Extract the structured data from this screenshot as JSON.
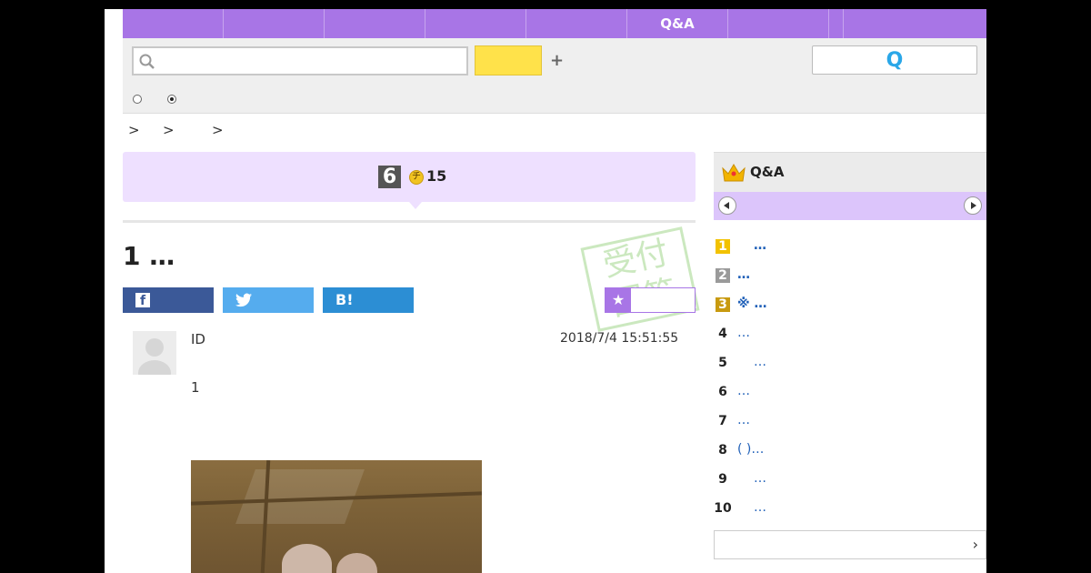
{
  "nav": {
    "tabs": [
      "",
      "",
      "",
      "",
      "",
      "Q&A",
      "",
      "",
      ""
    ]
  },
  "search": {
    "placeholder": "",
    "submit_label": "",
    "plus": "+",
    "ask_label": "Q"
  },
  "breadcrumb": [
    ">",
    ">",
    ">"
  ],
  "status": {
    "level": "6",
    "coin_symbol": "チ",
    "coin_value": "15"
  },
  "question": {
    "title": "1 …",
    "stamp_text": "受付\n回答",
    "share": {
      "facebook": "f",
      "twitter": "",
      "hatena": "B!"
    },
    "favorite_icon": "★",
    "user_id": "ID",
    "date": "2018/7/4  15:51:55",
    "body": "1"
  },
  "sidebar": {
    "title": "Q&A",
    "ranking": [
      {
        "rank": "1",
        "text": "…",
        "offset": 1
      },
      {
        "rank": "2",
        "text": "…",
        "offset": 0
      },
      {
        "rank": "3",
        "text": "※       …",
        "offset": 0
      },
      {
        "rank": "4",
        "text": "…",
        "offset": 0
      },
      {
        "rank": "5",
        "text": "…",
        "offset": 1
      },
      {
        "rank": "6",
        "text": "…",
        "offset": 0
      },
      {
        "rank": "7",
        "text": "…",
        "offset": 0
      },
      {
        "rank": "8",
        "text": "(  )…",
        "offset": 0
      },
      {
        "rank": "9",
        "text": "…",
        "offset": 1
      },
      {
        "rank": "10",
        "text": "…",
        "offset": 1
      }
    ],
    "more_chevron": "›"
  },
  "colors": {
    "accent": "#a875e6",
    "rank1": "#f2c200",
    "rank2": "#9a9a9a",
    "rank3": "#c89a10",
    "link": "#2060b8"
  }
}
